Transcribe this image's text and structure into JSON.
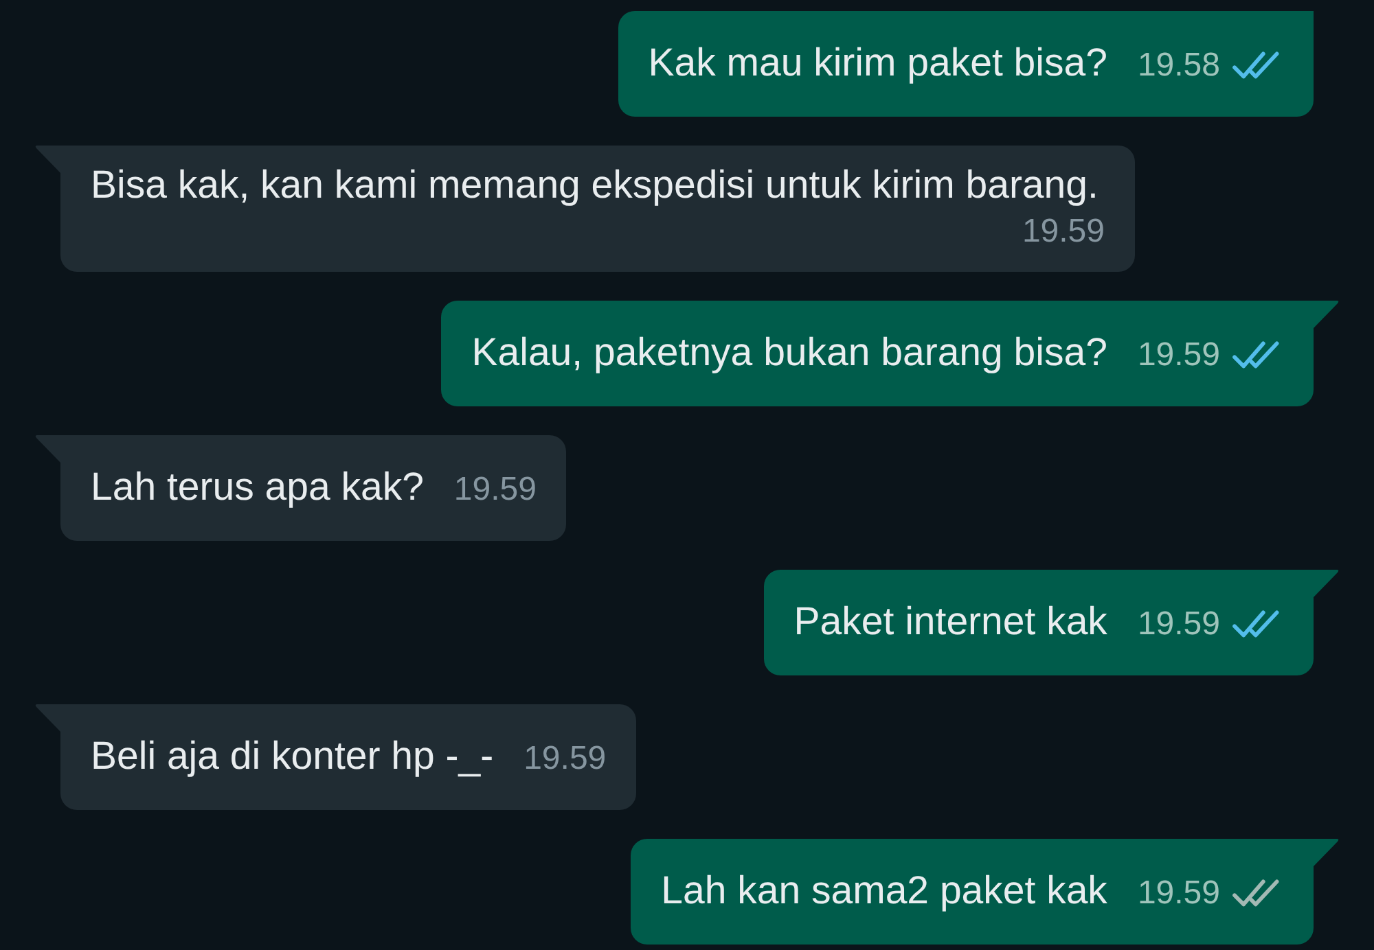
{
  "messages": [
    {
      "kind": "outgoing",
      "text": "Kak mau kirim paket bisa?",
      "time": "19.58",
      "read": true,
      "tail": false
    },
    {
      "kind": "incoming",
      "text": "Bisa kak, kan kami memang ekspedisi untuk kirim barang.",
      "time": "19.59",
      "tail": true
    },
    {
      "kind": "outgoing",
      "text": "Kalau, paketnya bukan barang bisa?",
      "time": "19.59",
      "read": true,
      "tail": true
    },
    {
      "kind": "incoming",
      "text": "Lah terus apa kak?",
      "time": "19.59",
      "tail": true
    },
    {
      "kind": "outgoing",
      "text": "Paket internet kak",
      "time": "19.59",
      "read": true,
      "tail": true
    },
    {
      "kind": "incoming",
      "text": "Beli aja di konter hp -_-",
      "time": "19.59",
      "tail": true
    },
    {
      "kind": "outgoing",
      "text": "Lah kan sama2 paket kak",
      "time": "19.59",
      "read": false,
      "tail": true
    }
  ]
}
